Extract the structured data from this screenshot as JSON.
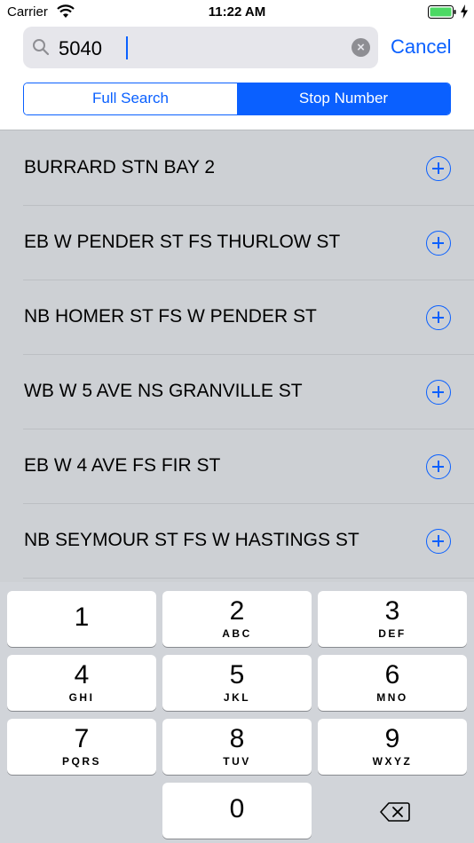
{
  "status_bar": {
    "carrier": "Carrier",
    "time": "11:22 AM"
  },
  "search": {
    "value": "5040",
    "cancel_label": "Cancel"
  },
  "segments": [
    {
      "label": "Full Search",
      "selected": false
    },
    {
      "label": "Stop Number",
      "selected": true
    }
  ],
  "results": [
    {
      "label": "BURRARD STN BAY 2"
    },
    {
      "label": "EB W PENDER ST FS THURLOW ST"
    },
    {
      "label": "NB HOMER ST FS W PENDER ST"
    },
    {
      "label": "WB W 5 AVE NS GRANVILLE ST"
    },
    {
      "label": "EB W 4 AVE FS FIR ST"
    },
    {
      "label": "NB SEYMOUR ST FS W HASTINGS ST"
    }
  ],
  "keypad": {
    "keys": [
      {
        "num": "1",
        "letters": ""
      },
      {
        "num": "2",
        "letters": "ABC"
      },
      {
        "num": "3",
        "letters": "DEF"
      },
      {
        "num": "4",
        "letters": "GHI"
      },
      {
        "num": "5",
        "letters": "JKL"
      },
      {
        "num": "6",
        "letters": "MNO"
      },
      {
        "num": "7",
        "letters": "PQRS"
      },
      {
        "num": "8",
        "letters": "TUV"
      },
      {
        "num": "9",
        "letters": "WXYZ"
      },
      {
        "num": "0",
        "letters": ""
      }
    ]
  },
  "colors": {
    "accent": "#0a60ff",
    "list_background": "#cdd0d4",
    "keypad_background": "#d1d4d9"
  },
  "icons": [
    "wifi-icon",
    "battery-icon",
    "charging-icon",
    "search-icon",
    "clear-icon",
    "add-icon",
    "backspace-icon"
  ]
}
